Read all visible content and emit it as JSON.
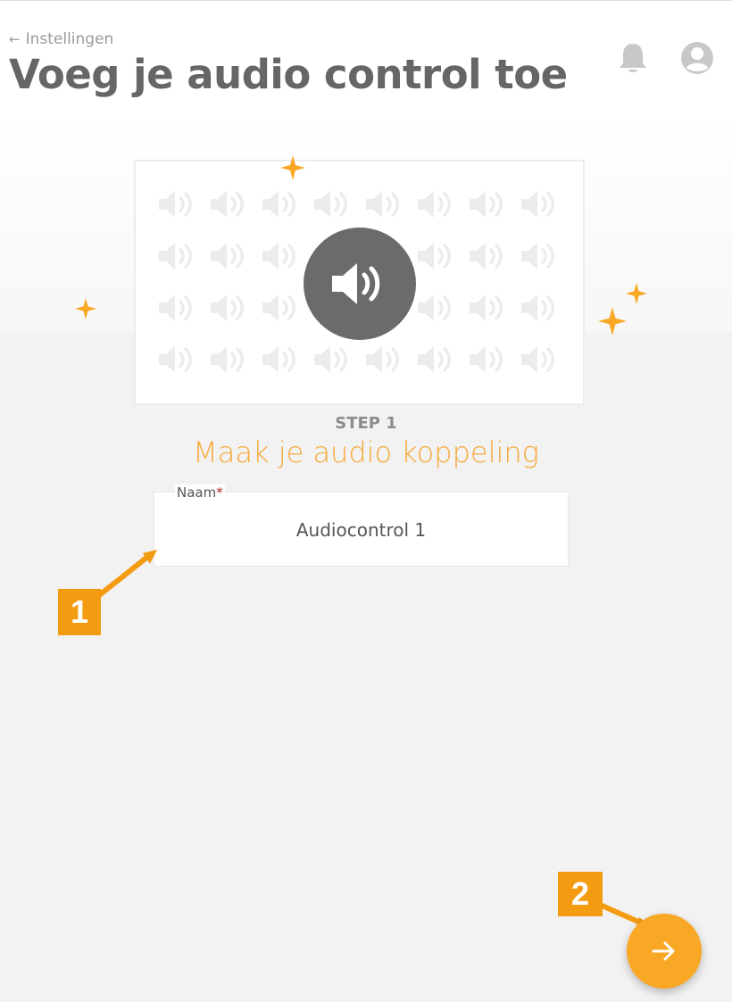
{
  "header": {
    "back_label": "Instellingen",
    "title": "Voeg je audio control toe"
  },
  "icons": {
    "back": "arrow-left-icon",
    "notifications": "bell-icon",
    "account": "user-circle-icon",
    "speaker": "speaker-volume-icon",
    "next": "arrow-right-icon",
    "sparkle": "sparkle-icon"
  },
  "step": {
    "label": "STEP 1",
    "title": "Maak je audio koppeling"
  },
  "form": {
    "name_label": "Naam",
    "name_required_mark": "*",
    "name_value": "Audiocontrol 1"
  },
  "callouts": {
    "one": "1",
    "two": "2"
  },
  "colors": {
    "accent": "#f9a825",
    "callout": "#f39c12",
    "title_text": "#666666",
    "step_title": "#f7a93a",
    "speaker_circle": "#6b6b6b"
  }
}
